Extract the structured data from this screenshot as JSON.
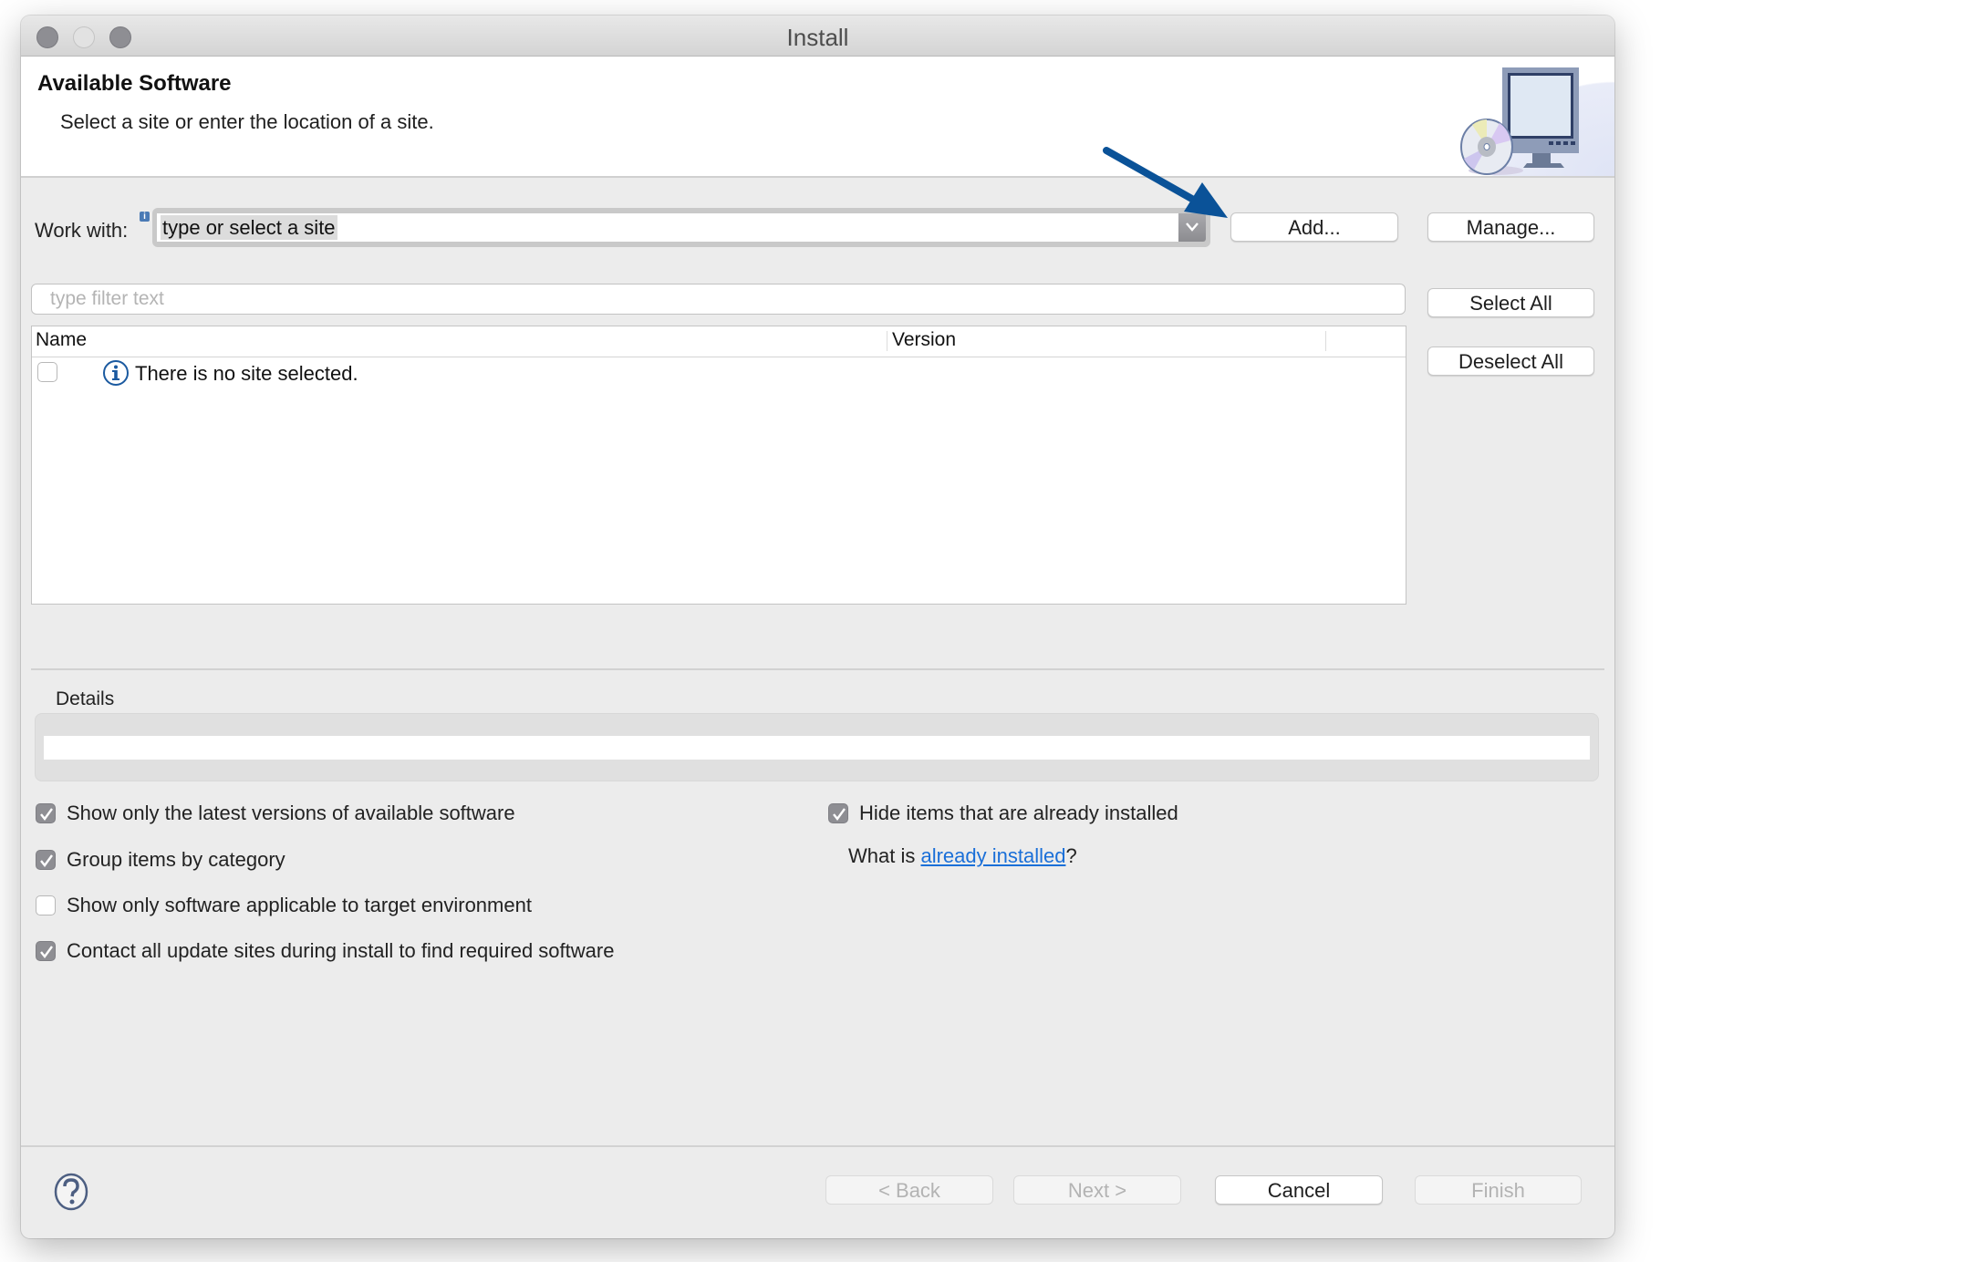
{
  "window": {
    "title": "Install"
  },
  "header": {
    "title": "Available Software",
    "subtitle": "Select a site or enter the location of a site.",
    "banner_icon": "install-monitor-cd-icon"
  },
  "work_with": {
    "label": "Work with:",
    "info_badge": "i",
    "value": "type or select a site",
    "add_button": "Add...",
    "manage_button": "Manage..."
  },
  "filter": {
    "placeholder": "type filter text",
    "value": ""
  },
  "side_buttons": {
    "select_all": "Select All",
    "deselect_all": "Deselect All"
  },
  "table": {
    "columns": [
      "Name",
      "Version"
    ],
    "rows": [
      {
        "checked": false,
        "icon": "info-icon",
        "name": "There is no site selected.",
        "version": ""
      }
    ]
  },
  "details": {
    "label": "Details",
    "value": ""
  },
  "options": {
    "left": [
      {
        "label": "Show only the latest versions of available software",
        "checked": true
      },
      {
        "label": "Group items by category",
        "checked": true
      },
      {
        "label": "Show only software applicable to target environment",
        "checked": false
      },
      {
        "label": "Contact all update sites during install to find required software",
        "checked": true
      }
    ],
    "right": [
      {
        "label": "Hide items that are already installed",
        "checked": true
      }
    ],
    "what_is_prefix": "What is ",
    "what_is_link": "already installed",
    "what_is_suffix": "?"
  },
  "footer": {
    "help_icon": "help-icon",
    "back": "< Back",
    "next": "Next >",
    "cancel": "Cancel",
    "finish": "Finish",
    "back_enabled": false,
    "next_enabled": false,
    "cancel_enabled": true,
    "finish_enabled": false
  },
  "annotation": {
    "arrow_color": "#0a5298",
    "points_to": "add-button"
  },
  "colors": {
    "link": "#1a6fd8",
    "dialog_bg": "#ececec",
    "checkbox_checked": "#8e8e93"
  }
}
